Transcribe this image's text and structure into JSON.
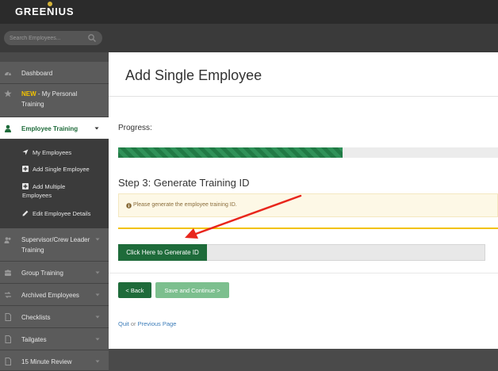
{
  "app": {
    "logo_text": "GREENIUS",
    "accent_color": "#1e6b3a",
    "logo_dot_color": "#d4b43a"
  },
  "search": {
    "placeholder": "Search Employees...",
    "icon": "search-icon"
  },
  "sidebar": {
    "items": [
      {
        "label": "Dashboard",
        "icon": "dashboard-icon"
      },
      {
        "badge": "NEW",
        "label": " - My Personal Training",
        "icon": "star-icon"
      },
      {
        "label": "Employee Training",
        "icon": "user-icon",
        "active": true
      },
      {
        "label": "Supervisor/Crew Leader Training",
        "icon": "users-icon"
      },
      {
        "label": "Group Training",
        "icon": "group-icon"
      },
      {
        "label": "Archived Employees",
        "icon": "archive-icon"
      },
      {
        "label": "Checklists",
        "icon": "document-icon"
      },
      {
        "label": "Tailgates",
        "icon": "document-icon"
      },
      {
        "label": "15 Minute Review",
        "icon": "document-icon"
      }
    ],
    "submenu": [
      {
        "label": "My Employees",
        "icon": "location-arrow-icon"
      },
      {
        "label": "Add Single Employee",
        "icon": "plus-square-icon"
      },
      {
        "label": "Add Multiple Employees",
        "icon": "plus-square-icon"
      },
      {
        "label": "Edit Employee Details",
        "icon": "pencil-icon"
      }
    ]
  },
  "main": {
    "title": "Add Single Employee",
    "progress_label": "Progress:",
    "progress_fraction": 0.59,
    "step_title": "Step 3: Generate Training ID",
    "alert_text": "Please generate the employee training ID.",
    "generate_button": "Click Here to Generate ID",
    "back_button": "< Back",
    "save_button": "Save and Continue >",
    "quit_link": "Quit",
    "or_text": "or",
    "previous_link": "Previous Page"
  },
  "annotation": {
    "arrow_color": "#e8261c"
  }
}
